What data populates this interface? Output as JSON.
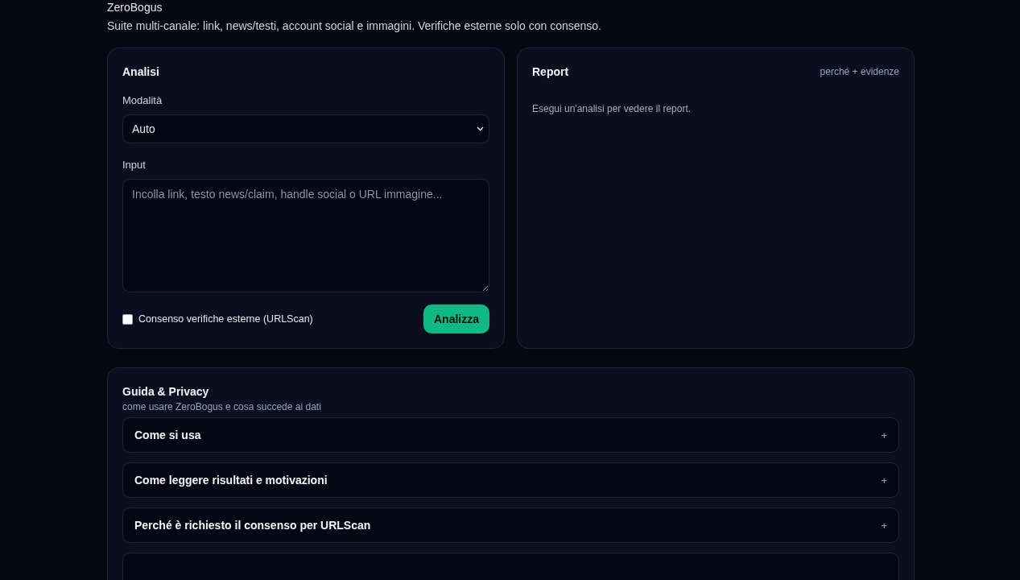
{
  "header": {
    "title": "ZeroBogus",
    "subtitle": "Suite multi-canale: link, news/testi, account social e immagini. Verifiche esterne solo con consenso."
  },
  "analysis": {
    "title": "Analisi",
    "mode_label": "Modalità",
    "mode_value": "Auto",
    "input_label": "Input",
    "input_placeholder": "Incolla link, testo news/claim, handle social o URL immagine...",
    "consent": {
      "label": "Consenso verifiche esterne (URLScan)",
      "checked": false
    },
    "button": "Analizza"
  },
  "report": {
    "title": "Report",
    "hint": "perché + evidenze",
    "empty_text": "Esegui un'analisi per vedere il report."
  },
  "guide": {
    "title": "Guida & Privacy",
    "subtitle": "come usare ZeroBogus e cosa succede ai dati",
    "items": [
      {
        "kind": "section",
        "label": "Come si usa",
        "toggle": "+"
      },
      {
        "kind": "section",
        "label": "Come leggere risultati e motivazioni",
        "toggle": "+"
      },
      {
        "kind": "section",
        "label": "Perché è richiesto il consenso per URLScan",
        "toggle": "+"
      },
      {
        "kind": "cut"
      }
    ]
  }
}
